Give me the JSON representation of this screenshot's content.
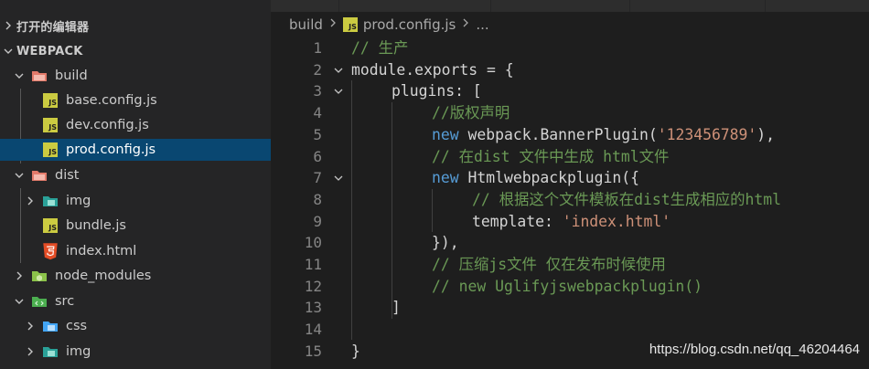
{
  "sidebar": {
    "open_editors_label": "打开的编辑器",
    "project_label": "WEBPACK",
    "tree": {
      "build": "build",
      "build_files": [
        "base.config.js",
        "dev.config.js",
        "prod.config.js"
      ],
      "dist": "dist",
      "dist_img": "img",
      "dist_bundle": "bundle.js",
      "dist_index": "index.html",
      "node_modules": "node_modules",
      "src": "src",
      "src_css": "css",
      "src_img": "img"
    },
    "js_badge": "JS"
  },
  "breadcrumb": {
    "folder": "build",
    "file": "prod.config.js",
    "tail": "..."
  },
  "editor": {
    "line_numbers": [
      "1",
      "2",
      "3",
      "4",
      "5",
      "6",
      "7",
      "8",
      "9",
      "10",
      "11",
      "12",
      "13",
      "14",
      "15"
    ],
    "lines": {
      "l1": "// 生产",
      "l2a": "module.exports = {",
      "l3a": "plugins: [",
      "l4": "//版权声明",
      "l5_new": "new",
      "l5_obj": "webpack",
      "l5_fn": "BannerPlugin",
      "l5_str": "'123456789'",
      "l5_end": "),",
      "l6": "// 在dist 文件中生成 html文件",
      "l7_new": "new",
      "l7_fn": "Htmlwebpackplugin",
      "l7_end": "({",
      "l8": "// 根据这个文件模板在dist生成相应的html",
      "l9_key": "template",
      "l9_str": "'index.html'",
      "l10": "}),",
      "l11": "// 压缩js文件 仅在发布时候使用",
      "l12": "// new Uglifyjswebpackplugin()",
      "l13": "]",
      "l15": "}"
    }
  },
  "watermark": "https://blog.csdn.net/qq_46204464",
  "colors": {
    "selection": "#094771",
    "comment": "#6a9955",
    "keyword": "#569cd6",
    "string": "#ce9178",
    "function": "#dcdcaa",
    "variable": "#9cdcfe"
  }
}
